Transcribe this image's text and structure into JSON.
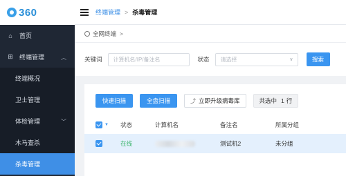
{
  "logo": {
    "text": "360"
  },
  "sidebar": {
    "items": [
      {
        "label": "首页",
        "icon": "home-icon"
      },
      {
        "label": "终端管理",
        "icon": "grid-icon",
        "caret": "^"
      },
      {
        "label": "终端概况"
      },
      {
        "label": "卫士管理"
      },
      {
        "label": "体检管理",
        "caret": "v"
      },
      {
        "label": "木马查杀"
      },
      {
        "label": "杀毒管理",
        "active": true
      }
    ]
  },
  "breadcrumb": {
    "parent": "终端管理",
    "separator": ">",
    "current": "杀毒管理"
  },
  "scope": {
    "label": "全网终端",
    "chevron": ">"
  },
  "filters": {
    "keyword_label": "关键词",
    "keyword_placeholder": "计算机名/IP/备注名",
    "status_label": "状态",
    "status_placeholder": "请选择",
    "search_button": "搜索"
  },
  "toolbar": {
    "quick_scan": "快速扫描",
    "full_scan": "全盘扫描",
    "upgrade": "立即升级病毒库",
    "selected_prefix": "共选中",
    "selected_count": "1",
    "selected_suffix": "行"
  },
  "table": {
    "columns": [
      "状态",
      "计算机名",
      "备注名",
      "所属分组"
    ],
    "rows": [
      {
        "status": "在线",
        "name": "",
        "note": "测试机2",
        "group": "未分组"
      }
    ]
  },
  "colors": {
    "accent": "#3a95f0",
    "sidebar_bg": "#1f2734",
    "online": "#3bb46a",
    "row_selected": "#e4f0fd"
  }
}
